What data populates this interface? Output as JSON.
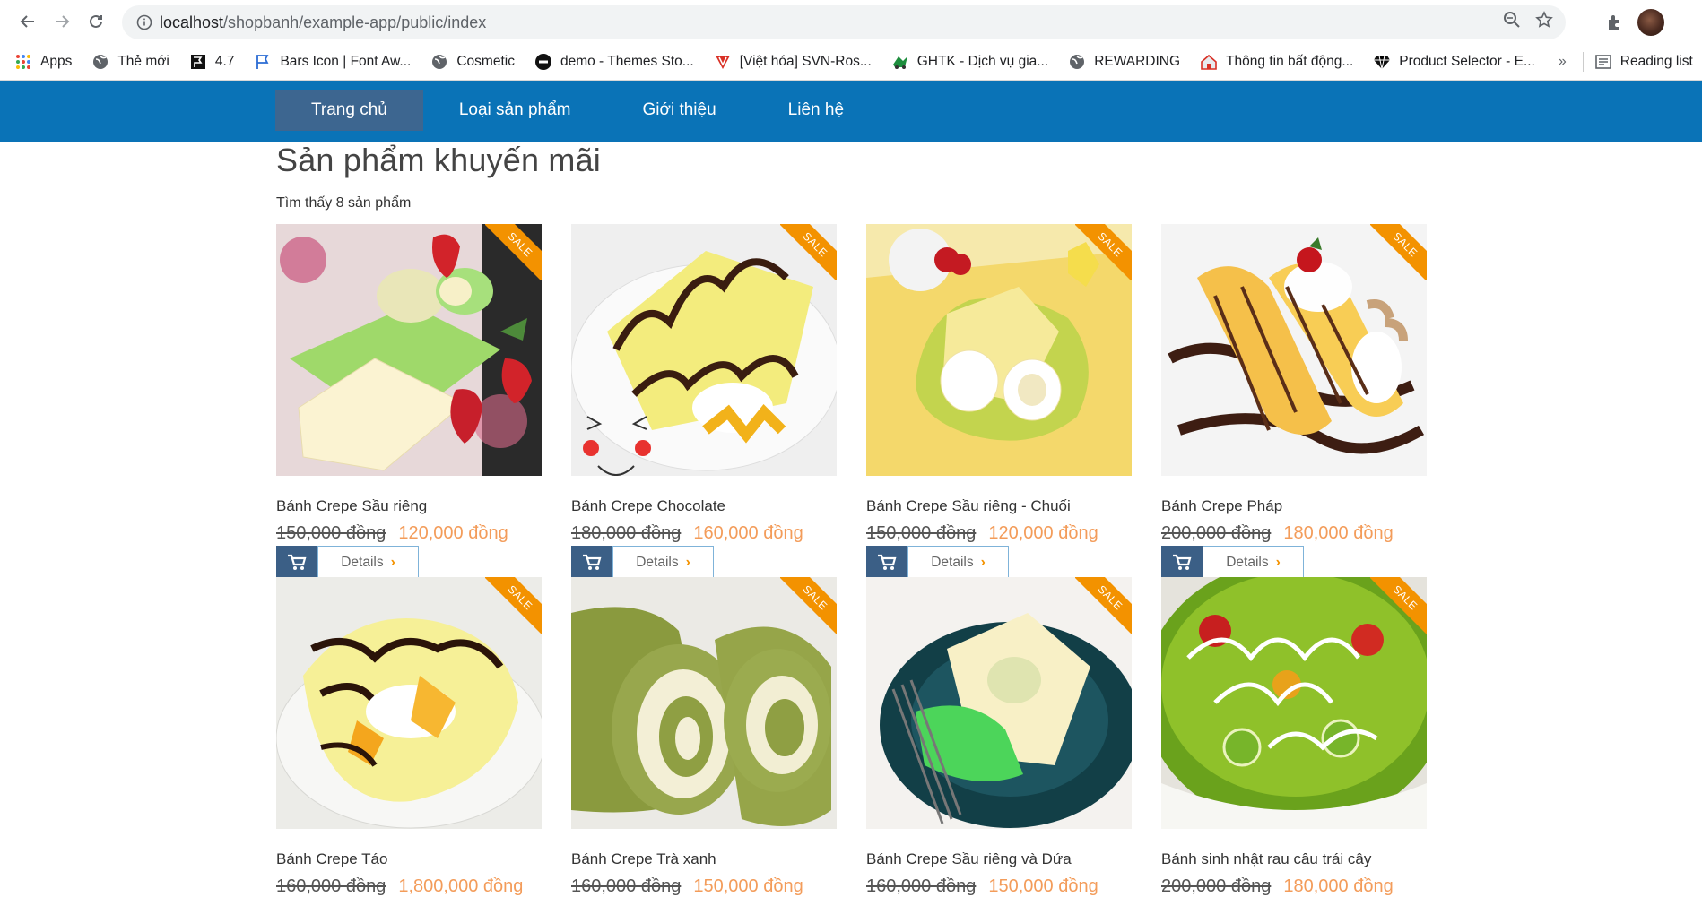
{
  "browser": {
    "url_host": "localhost",
    "url_path": "/shopbanh/example-app/public/index",
    "bookmarks": [
      {
        "label": "Apps",
        "icon": "apps-grid-icon"
      },
      {
        "label": "Thẻ mới",
        "icon": "globe-icon"
      },
      {
        "label": "4.7",
        "icon": "flag-icon"
      },
      {
        "label": "Bars Icon | Font Aw...",
        "icon": "flag-outline-icon"
      },
      {
        "label": "Cosmetic",
        "icon": "globe-icon"
      },
      {
        "label": "demo - Themes Sto...",
        "icon": "logo-circle-icon"
      },
      {
        "label": "[Việt hóa] SVN-Ros...",
        "icon": "v-shield-icon"
      },
      {
        "label": "GHTK - Dịch vụ gia...",
        "icon": "ghtk-icon"
      },
      {
        "label": "REWARDING",
        "icon": "globe-icon"
      },
      {
        "label": "Thông tin bất động...",
        "icon": "house-icon"
      },
      {
        "label": "Product Selector - E...",
        "icon": "diamond-icon"
      }
    ],
    "more_label": "»",
    "reading_list": "Reading list"
  },
  "site": {
    "menu": [
      {
        "label": "Trang chủ",
        "active": true
      },
      {
        "label": "Loại sản phẩm",
        "active": false
      },
      {
        "label": "Giới thiệu",
        "active": false
      },
      {
        "label": "Liên hệ",
        "active": false
      }
    ],
    "title": "Sản phẩm khuyến mãi",
    "found_text": "Tìm thấy 8 sản phẩm",
    "sale_label": "SALE",
    "details_label": "Details"
  },
  "products": [
    {
      "name": "Bánh Crepe Sầu riêng",
      "old_price": "150,000 đồng",
      "new_price": "120,000 đồng"
    },
    {
      "name": "Bánh Crepe Chocolate",
      "old_price": "180,000 đồng",
      "new_price": "160,000 đồng"
    },
    {
      "name": "Bánh Crepe Sầu riêng - Chuối",
      "old_price": "150,000 đồng",
      "new_price": "120,000 đồng"
    },
    {
      "name": "Bánh Crepe Pháp",
      "old_price": "200,000 đồng",
      "new_price": "180,000 đồng"
    },
    {
      "name": "Bánh Crepe Táo",
      "old_price": "160,000 đồng",
      "new_price": "1,800,000 đồng"
    },
    {
      "name": "Bánh Crepe Trà xanh",
      "old_price": "160,000 đồng",
      "new_price": "150,000 đồng"
    },
    {
      "name": "Bánh Crepe Sầu riêng và Dứa",
      "old_price": "160,000 đồng",
      "new_price": "150,000 đồng"
    },
    {
      "name": "Bánh sinh nhật rau câu trái cây",
      "old_price": "200,000 đồng",
      "new_price": "180,000 đồng"
    }
  ],
  "colors": {
    "nav_bg": "#0a73b7",
    "nav_active": "#3d6690",
    "sale": "#f39200",
    "price_new": "#f39c5a",
    "cart_btn": "#3b5f86"
  }
}
